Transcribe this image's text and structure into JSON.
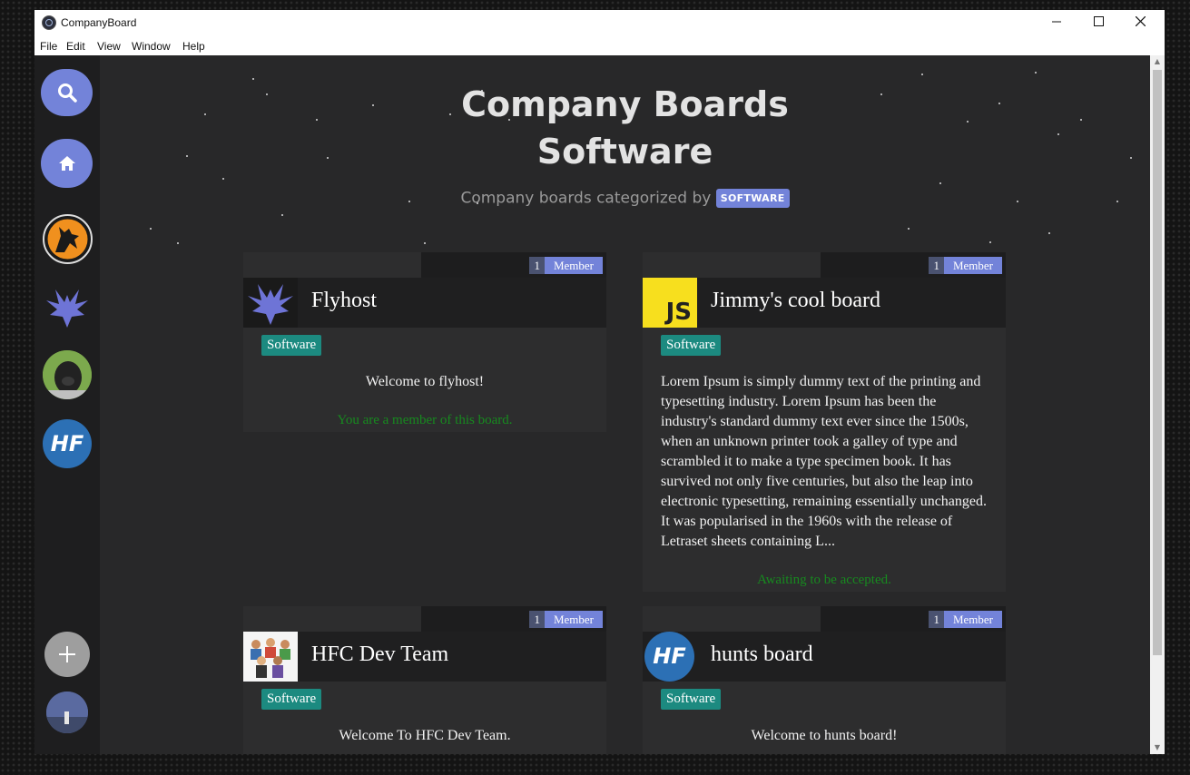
{
  "window": {
    "title": "CompanyBoard"
  },
  "menu": [
    "File",
    "Edit",
    "View",
    "Window",
    "Help"
  ],
  "sidebar": {
    "search_icon": "search-icon",
    "home_icon": "home-icon",
    "add_icon": "plus-icon",
    "boards": [
      "wolf-board-avatar",
      "flyhost-board-avatar",
      "pug-board-avatar",
      "hf-board-avatar"
    ],
    "hf_text": "HF"
  },
  "header": {
    "title_line1": "Company Boards",
    "title_line2": "Software",
    "subtitle": "Company boards categorized by",
    "badge": "SOFTWARE"
  },
  "member_label": "Member",
  "cards": [
    {
      "title": "Flyhost",
      "member_count": "1",
      "tag": "Software",
      "description": "Welcome to flyhost!",
      "status": "You are a member of this board."
    },
    {
      "title": "Jimmy's cool board",
      "member_count": "1",
      "tag": "Software",
      "logo_text": "JS",
      "description": "Lorem Ipsum is simply dummy text of the printing and typesetting industry. Lorem Ipsum has been the industry's standard dummy text ever since the 1500s, when an unknown printer took a galley of type and scrambled it to make a type specimen book. It has survived not only five centuries, but also the leap into electronic typesetting, remaining essentially unchanged. It was popularised in the 1960s with the release of Letraset sheets containing L...",
      "status": "Awaiting to be accepted."
    },
    {
      "title": "HFC Dev Team",
      "member_count": "1",
      "tag": "Software",
      "description": "Welcome To HFC Dev Team."
    },
    {
      "title": "hunts board",
      "member_count": "1",
      "tag": "Software",
      "logo_text": "HF",
      "description": "Welcome to hunts board!"
    }
  ],
  "colors": {
    "accent": "#7383d9",
    "tag": "#1c8a80",
    "status_green": "#178a1f",
    "background": "#282829"
  }
}
